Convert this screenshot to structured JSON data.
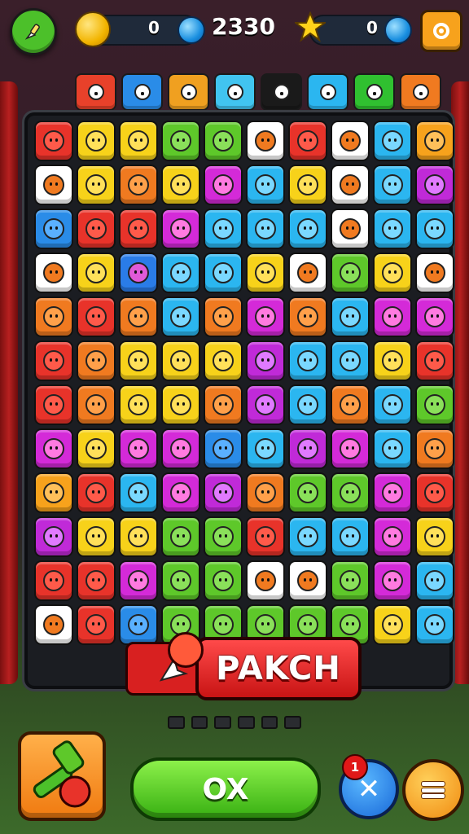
{
  "hud": {
    "left_counter": "0",
    "score": "2330",
    "right_counter": "0"
  },
  "goals": [
    {
      "icon": "diamond-candy-icon",
      "color": "#e8412a"
    },
    {
      "icon": "helmet-icon",
      "color": "#2a8ce8"
    },
    {
      "icon": "shoe-icon",
      "color": "#f0a020"
    },
    {
      "icon": "heart-icon",
      "color": "#41c4f0"
    },
    {
      "icon": "apple-icon",
      "color": "#1a1a1a"
    },
    {
      "icon": "lemon-icon",
      "color": "#2bb6f0"
    },
    {
      "icon": "apple-icon",
      "color": "#30c030"
    },
    {
      "icon": "face-icon",
      "color": "#f07a20"
    }
  ],
  "board": {
    "rows": [
      [
        "#e8332a",
        "#f7d21a",
        "#f7d21a",
        "#5ec82a",
        "#5ec82a",
        "#ffffff",
        "#e8332a",
        "#ffffff",
        "#2bb6f0",
        "#f7a21c"
      ],
      [
        "#ffffff",
        "#f7d21a",
        "#f07a20",
        "#f7d21a",
        "#d42ad8",
        "#2bb6f0",
        "#f7d21a",
        "#ffffff",
        "#2bb6f0",
        "#c02ad8"
      ],
      [
        "#2a8ce8",
        "#e8332a",
        "#e8332a",
        "#d42ad8",
        "#2bb6f0",
        "#2bb6f0",
        "#2bb6f0",
        "#ffffff",
        "#2bb6f0",
        "#2bb6f0"
      ],
      [
        "#ffffff",
        "#f7d21a",
        "#2a7ce8",
        "#2bb6f0",
        "#2bb6f0",
        "#f7d21a",
        "#ffffff",
        "#5ec82a",
        "#f7d21a",
        "#ffffff"
      ],
      [
        "#f07a20",
        "#e8332a",
        "#f07a20",
        "#2bb6f0",
        "#f07a20",
        "#d42ad8",
        "#f07a20",
        "#2bb6f0",
        "#d42ad8",
        "#d42ad8"
      ],
      [
        "#e8332a",
        "#f07a20",
        "#f7d21a",
        "#f7d21a",
        "#f7d21a",
        "#c02ad8",
        "#2bb6f0",
        "#2bb6f0",
        "#f7d21a",
        "#e8332a"
      ],
      [
        "#e8332a",
        "#f07a20",
        "#f7d21a",
        "#f7d21a",
        "#f07a20",
        "#c02ad8",
        "#2bb6f0",
        "#f07a20",
        "#2bb6f0",
        "#5ec82a"
      ],
      [
        "#d42ad8",
        "#f7d21a",
        "#d42ad8",
        "#d42ad8",
        "#2a8ce8",
        "#2bb6f0",
        "#c02ad8",
        "#d42ad8",
        "#2bb6f0",
        "#f07a20"
      ],
      [
        "#f7a21c",
        "#e8332a",
        "#2bb6f0",
        "#d42ad8",
        "#c02ad8",
        "#f07a20",
        "#5ec82a",
        "#5ec82a",
        "#d42ad8",
        "#e8332a"
      ],
      [
        "#c02ad8",
        "#f7d21a",
        "#f7d21a",
        "#5ec82a",
        "#5ec82a",
        "#e8332a",
        "#2bb6f0",
        "#2bb6f0",
        "#d42ad8",
        "#f7d21a"
      ],
      [
        "#e8332a",
        "#e8332a",
        "#d42ad8",
        "#5ec82a",
        "#5ec82a",
        "#ffffff",
        "#ffffff",
        "#5ec82a",
        "#d42ad8",
        "#2bb6f0"
      ],
      [
        "#ffffff",
        "#e8332a",
        "#2a8ce8",
        "#5ec82a",
        "#5ec82a",
        "#5ec82a",
        "#5ec82a",
        "#5ec82a",
        "#f7d21a",
        "#2bb6f0"
      ]
    ]
  },
  "banner": {
    "label": "PAKCH"
  },
  "bottom": {
    "ok_label": "OX",
    "x_badge": "1",
    "x_symbol": "✕"
  }
}
